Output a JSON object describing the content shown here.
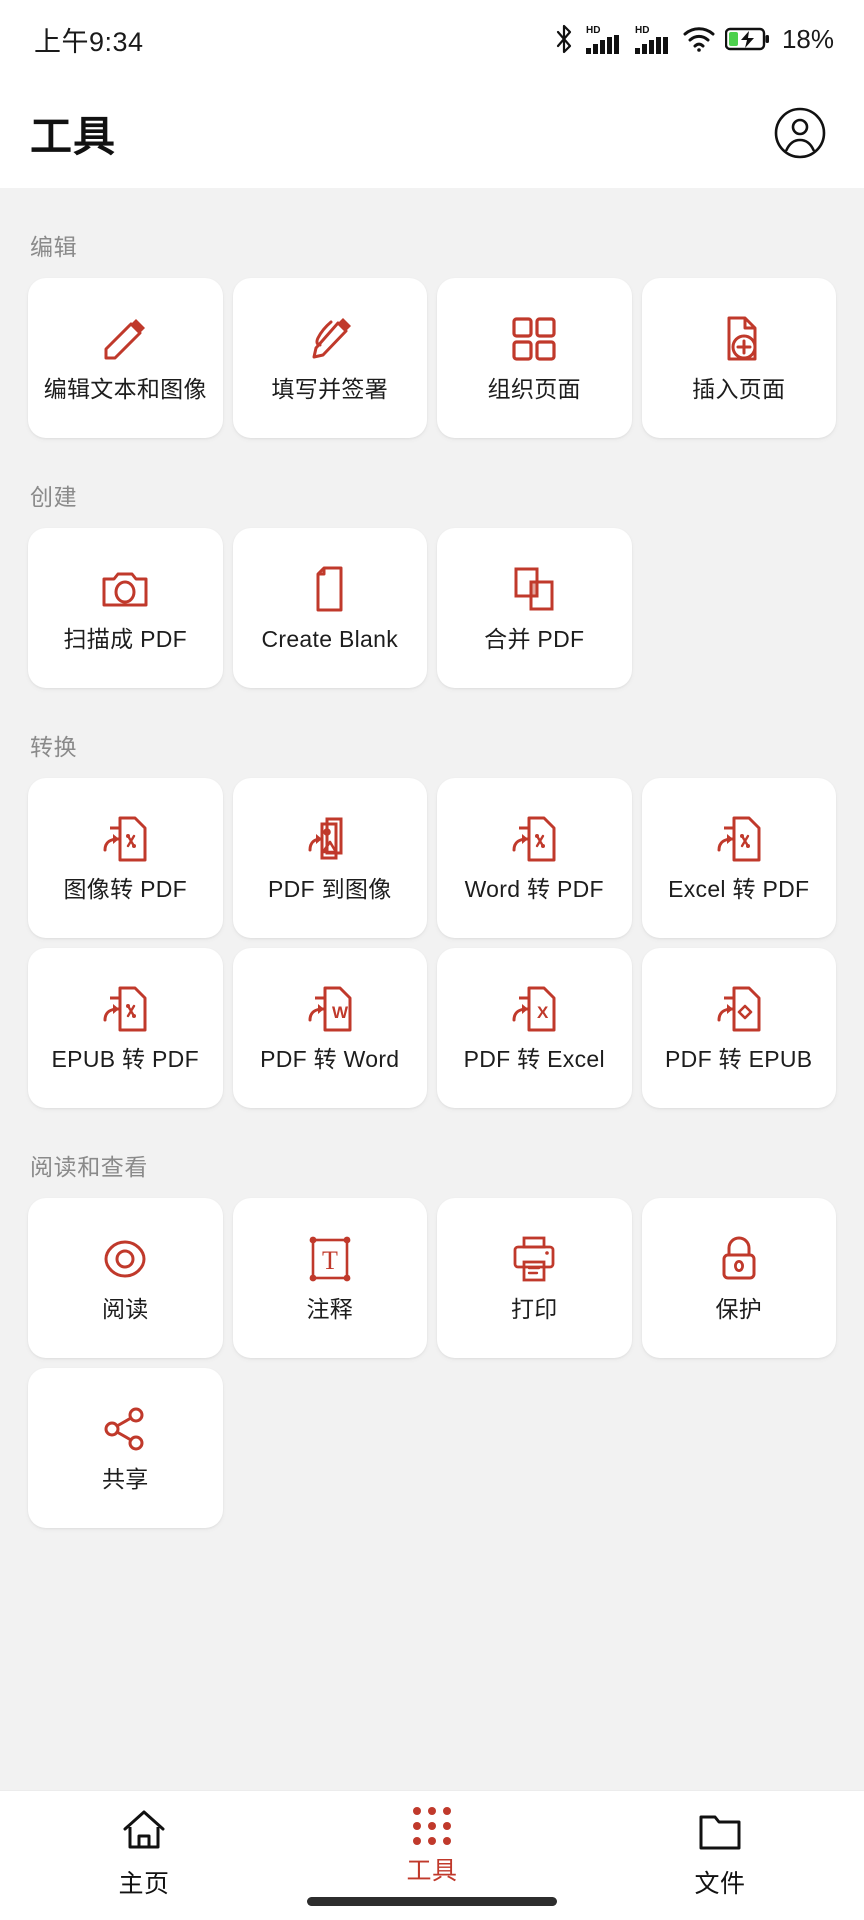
{
  "theme": {
    "accent": "#C0392B",
    "background": "#f2f2f2",
    "card": "#ffffff",
    "text": "#1d1d1d",
    "muted": "#8a8a8a"
  },
  "statusbar": {
    "time": "上午9:34",
    "battery_percent": "18%",
    "icons": [
      "bluetooth-icon",
      "hd-signal-icon",
      "hd-signal-icon-2",
      "wifi-icon",
      "battery-charging-icon"
    ]
  },
  "header": {
    "title": "工具",
    "account_icon": "account-circle-icon"
  },
  "sections": [
    {
      "title": "编辑",
      "items": [
        {
          "label": "编辑文本和图像",
          "icon": "pencil-icon"
        },
        {
          "label": "填写并签署",
          "icon": "pen-signature-icon"
        },
        {
          "label": "组织页面",
          "icon": "grid-pages-icon"
        },
        {
          "label": "插入页面",
          "icon": "document-plus-icon"
        }
      ]
    },
    {
      "title": "创建",
      "items": [
        {
          "label": "扫描成 PDF",
          "icon": "camera-icon"
        },
        {
          "label": "Create Blank",
          "icon": "blank-document-icon"
        },
        {
          "label": "合并 PDF",
          "icon": "merge-squares-icon"
        }
      ]
    },
    {
      "title": "转换",
      "items": [
        {
          "label": "图像转 PDF",
          "icon": "convert-to-pdf-icon"
        },
        {
          "label": "PDF 到图像",
          "icon": "pdf-to-image-icon"
        },
        {
          "label": "Word 转 PDF",
          "icon": "convert-to-pdf-icon"
        },
        {
          "label": "Excel 转 PDF",
          "icon": "convert-to-pdf-icon"
        },
        {
          "label": "EPUB 转 PDF",
          "icon": "convert-to-pdf-icon"
        },
        {
          "label": "PDF 转 Word",
          "icon": "pdf-to-word-icon"
        },
        {
          "label": "PDF 转 Excel",
          "icon": "pdf-to-excel-icon"
        },
        {
          "label": "PDF 转 EPUB",
          "icon": "pdf-to-epub-icon"
        }
      ]
    },
    {
      "title": "阅读和查看",
      "items": [
        {
          "label": "阅读",
          "icon": "eye-icon"
        },
        {
          "label": "注释",
          "icon": "text-annotation-icon"
        },
        {
          "label": "打印",
          "icon": "printer-icon"
        },
        {
          "label": "保护",
          "icon": "lock-icon"
        },
        {
          "label": "共享",
          "icon": "share-icon"
        }
      ]
    }
  ],
  "bottomnav": {
    "items": [
      {
        "label": "主页",
        "icon": "home-icon",
        "active": false
      },
      {
        "label": "工具",
        "icon": "tools-grid-icon",
        "active": true
      },
      {
        "label": "文件",
        "icon": "folder-icon",
        "active": false
      }
    ]
  }
}
